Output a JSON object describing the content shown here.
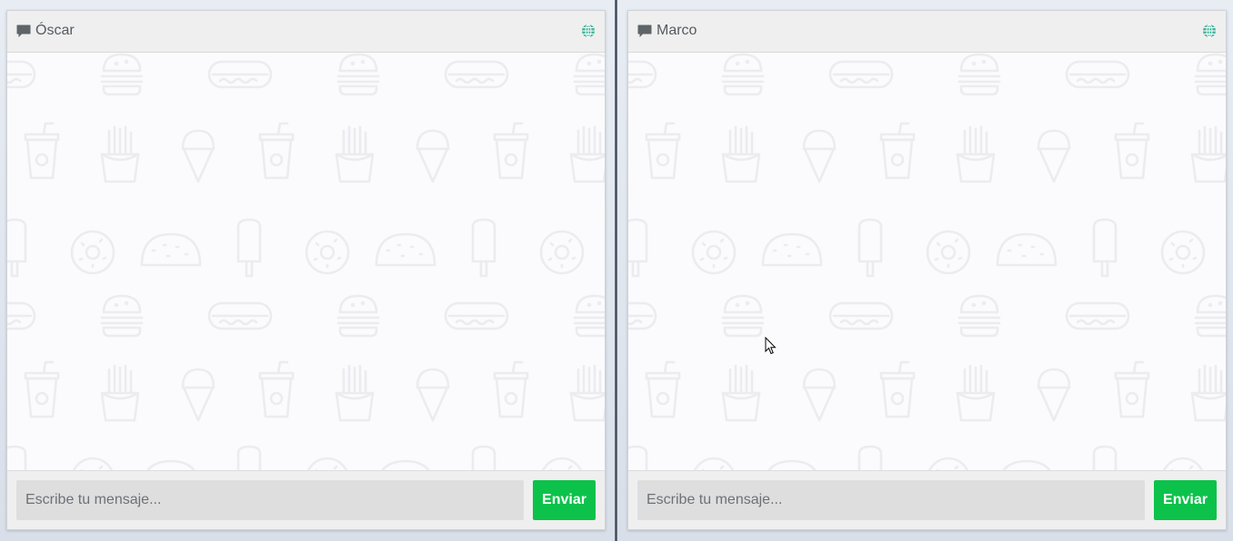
{
  "windows": [
    {
      "contact_name": "Óscar",
      "chat_icon": "chat-bubble-icon",
      "status_icon": "globe-icon",
      "status_color": "#43b49a",
      "input_placeholder": "Escribe tu mensaje...",
      "input_value": "",
      "send_label": "Enviar"
    },
    {
      "contact_name": "Marco",
      "chat_icon": "chat-bubble-icon",
      "status_icon": "globe-icon",
      "status_color": "#43b49a",
      "input_placeholder": "Escribe tu mensaje...",
      "input_value": "",
      "send_label": "Enviar"
    }
  ],
  "theme": {
    "send_button_color": "#0cc24a",
    "header_color": "#efefef",
    "pattern_color": "#ececf0"
  },
  "background_pattern_icons": [
    "hotdog-icon",
    "burger-icon",
    "soda-cup-icon",
    "fries-icon",
    "ice-cream-cone-icon",
    "taco-icon",
    "popsicle-icon",
    "donut-icon"
  ]
}
